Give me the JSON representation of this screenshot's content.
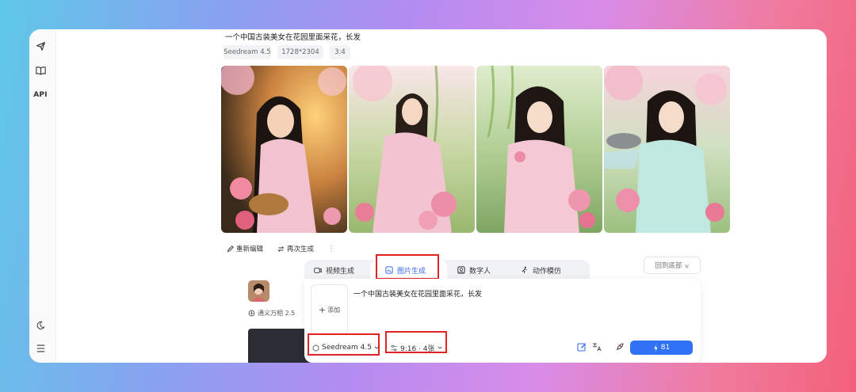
{
  "sidebar": {
    "api_label": "API"
  },
  "prompt": {
    "title": "一个中国古装美女在花园里面采花，长发",
    "chips": [
      "Seedream 4.5",
      "1728*2304",
      "3:4"
    ]
  },
  "actions": {
    "edit_label": "重新编辑",
    "regen_label": "再次生成",
    "more_label": "⋮"
  },
  "history": {
    "model_tag": "通义万相 2.5"
  },
  "tabs": [
    {
      "label": "视频生成",
      "active": false
    },
    {
      "label": "图片生成",
      "active": true
    },
    {
      "label": "数字人",
      "active": false
    },
    {
      "label": "动作模仿",
      "active": false
    }
  ],
  "back_to_bottom": "回到底部",
  "composer": {
    "add_label": "添加",
    "text": "一个中国古装美女在花园里面采花，长发",
    "model_select": "Seedream 4.5",
    "ratio_select": "9:16 · 4张",
    "generate_label": "81"
  },
  "colors": {
    "accent": "#2f72f5",
    "highlight": "#e02424"
  }
}
